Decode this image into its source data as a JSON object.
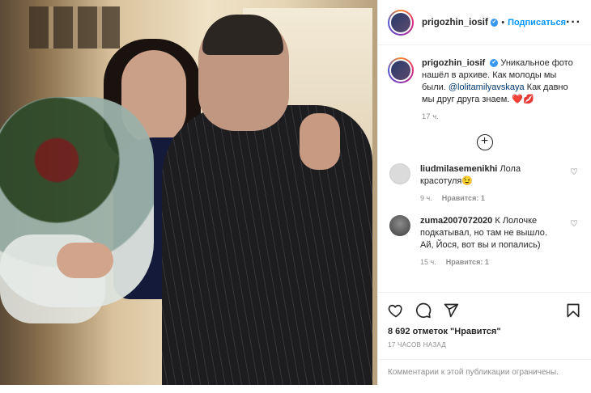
{
  "header": {
    "username": "prigozhin_iosif",
    "verified_mark": "✔",
    "separator": "•",
    "follow_label": "Подписаться",
    "more_label": "···"
  },
  "caption": {
    "username": "prigozhin_iosif",
    "text_part1": "Уникальное фото нашёл в архиве. Как молоды мы были.",
    "mention": "@lolitamilyavskaya",
    "text_part2": "Как давно мы друг друга знаем.",
    "emoji": "❤️💋",
    "time": "17 ч."
  },
  "load_more_icon": "plus-circle-icon",
  "comments": [
    {
      "username": "liudmilasemenikhi",
      "text": "Лола красотуля😉",
      "time": "9 ч.",
      "likes": "Нравится: 1"
    },
    {
      "username": "zuma2007072020",
      "text": "К Лолочке подкатывал, но там не вышло. Ай, Йося, вот вы и попались)",
      "time": "15 ч.",
      "likes": "Нравится: 1"
    }
  ],
  "actions": {
    "icons": [
      "heart-icon",
      "comment-icon",
      "share-icon",
      "bookmark-icon"
    ],
    "likes_text": "8 692 отметок \"Нравится\"",
    "posted_ago": "17 ЧАСОВ НАЗАД"
  },
  "comments_limited_text": "Комментарии к этой публикации ограничены.",
  "colors": {
    "link_blue": "#0095f6",
    "mention_blue": "#00376b",
    "muted_gray": "#8e8e8e",
    "border": "#efefef"
  }
}
